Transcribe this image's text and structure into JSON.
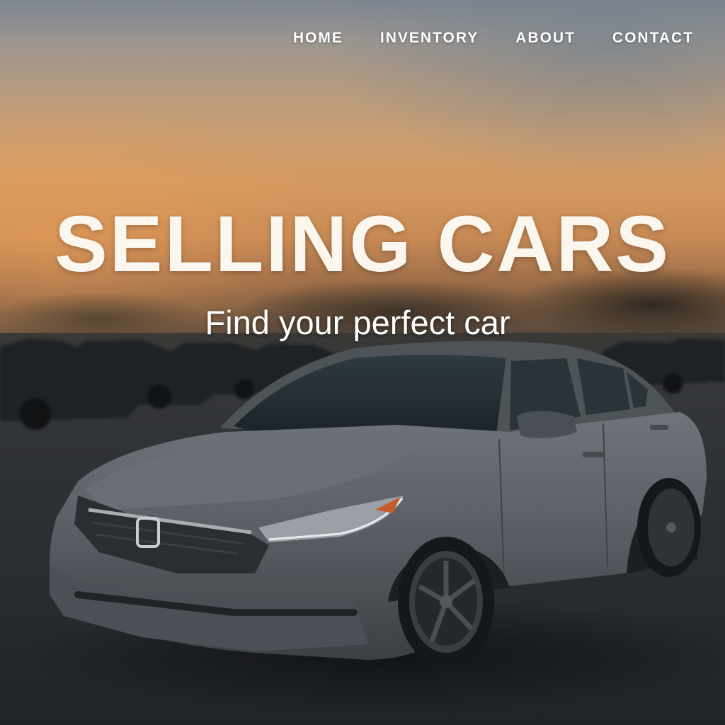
{
  "nav": {
    "items": [
      {
        "label": "HOME"
      },
      {
        "label": "INVENTORY"
      },
      {
        "label": "ABOUT"
      },
      {
        "label": "CONTACT"
      }
    ]
  },
  "hero": {
    "title": "SELLING CARS",
    "subtitle": "Find your perfect car",
    "image": "grey-sedan-at-sunset-car-lot-photo"
  },
  "colors": {
    "headline": "#fbf7ef",
    "nav_text": "#ffffff",
    "sky_warm": "#d59a60",
    "car_body": "#5d6268"
  }
}
